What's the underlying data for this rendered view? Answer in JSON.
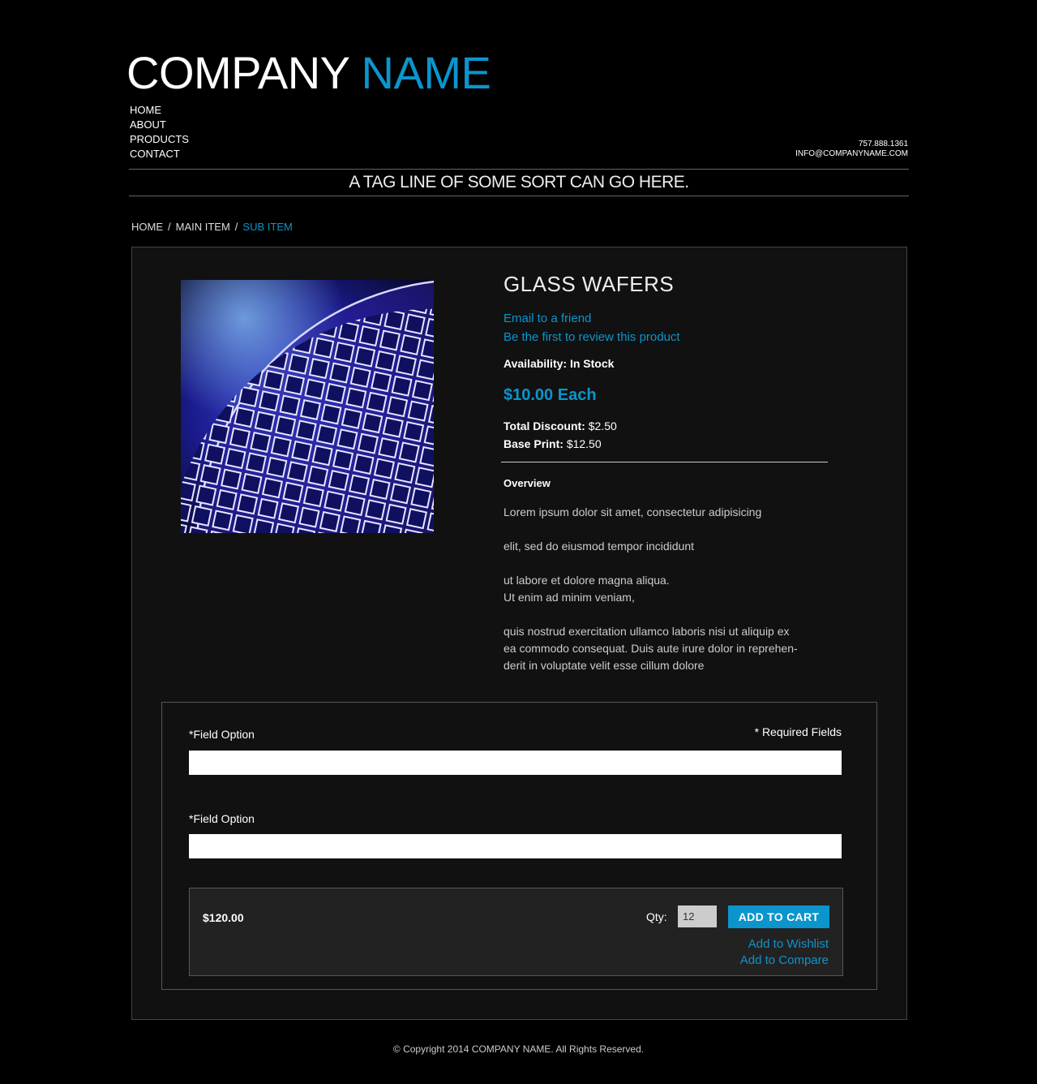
{
  "header": {
    "logo_company": "COMPANY",
    "logo_name": "NAME",
    "nav": [
      "HOME",
      "ABOUT",
      "PRODUCTS",
      "CONTACT"
    ],
    "phone": "757.888.1361",
    "email": "INFO@COMPANYNAME.COM",
    "tagline": "A TAG LINE OF SOME SORT CAN GO HERE."
  },
  "breadcrumb": {
    "items": [
      "HOME",
      "MAIN ITEM",
      "SUB ITEM"
    ],
    "separator": "/"
  },
  "product": {
    "title": "GLASS WAFERS",
    "email_friend": "Email to a friend",
    "review": "Be the first to review this product",
    "availability": "Availability: In Stock",
    "price": "$10.00 Each",
    "discount_label": "Total Discount:",
    "discount_value": "$2.50",
    "base_label": "Base Print:",
    "base_value": "$12.50",
    "overview_heading": "Overview",
    "overview_text": "Lorem ipsum dolor sit amet, consectetur adipisicing\n\nelit, sed do eiusmod tempor incididunt\n\n ut labore et dolore magna aliqua.\nUt enim ad minim veniam,\n\nquis nostrud exercitation ullamco laboris nisi ut aliquip ex\nea commodo consequat. Duis aute irure dolor in reprehen-\nderit in voluptate velit esse cillum dolore"
  },
  "form": {
    "required_note": "* Required Fields",
    "field1_label": "*Field Option",
    "field2_label": "*Field Option"
  },
  "cart": {
    "total": "$120.00",
    "qty_label": "Qty:",
    "qty_value": "12",
    "add_to_cart": "ADD TO CART",
    "wishlist": "Add to Wishlist",
    "compare": "Add to Compare"
  },
  "footer": {
    "copyright": "© Copyright 2014 COMPANY NAME. All Rights Reserved."
  },
  "colors": {
    "accent": "#0b95cc",
    "background": "#000000",
    "panel": "#111111"
  }
}
